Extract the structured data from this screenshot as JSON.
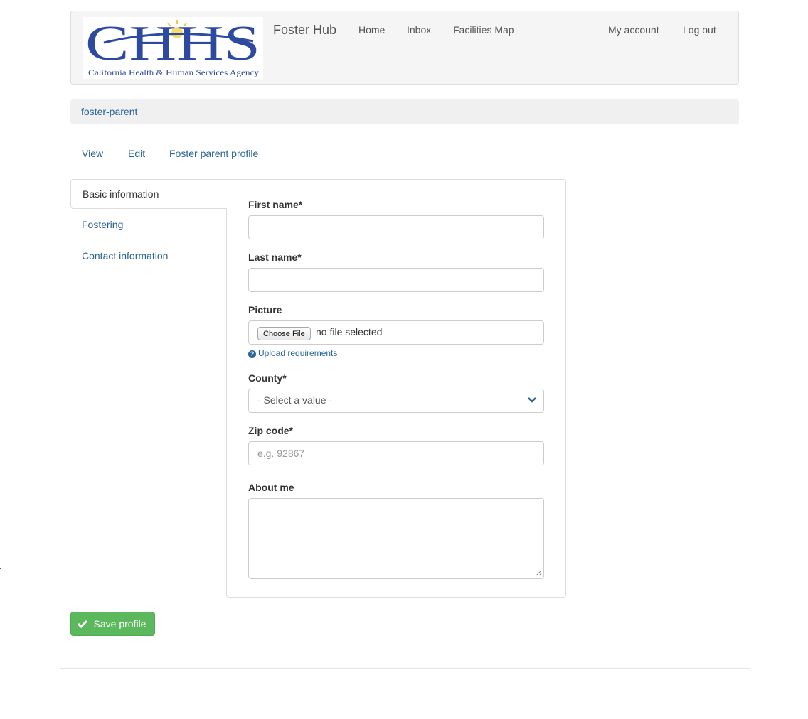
{
  "header": {
    "logo_alt": "CHHS California Health & Human Services Agency",
    "logo_letters": "CHHS",
    "logo_tagline": "California Health & Human Services Agency",
    "brand": "Foster Hub",
    "nav": [
      "Home",
      "Inbox",
      "Facilities Map"
    ],
    "user_nav": [
      "My account",
      "Log out"
    ]
  },
  "breadcrumb": {
    "current": "foster-parent"
  },
  "local_tabs": [
    "View",
    "Edit",
    "Foster parent profile"
  ],
  "vertical_tabs": {
    "items": [
      "Basic information",
      "Fostering",
      "Contact information"
    ],
    "active": "Basic information"
  },
  "form": {
    "first_name": {
      "label": "First name*",
      "value": "",
      "placeholder": ""
    },
    "last_name": {
      "label": "Last name*",
      "value": "",
      "placeholder": ""
    },
    "picture": {
      "label": "Picture",
      "button": "Choose File",
      "status": "no file selected",
      "help_link": "Upload requirements"
    },
    "county": {
      "label": "County*",
      "selected": "- Select a value -"
    },
    "zip": {
      "label": "Zip code*",
      "placeholder": "e.g. 92867"
    },
    "about": {
      "label": "About me",
      "value": ""
    }
  },
  "actions": {
    "save_label": "Save profile"
  },
  "colors": {
    "link": "#2a6496",
    "success": "#5cb85c",
    "navbar_bg": "#f5f5f5",
    "logo_blue": "#2e4aa0",
    "logo_sun": "#f2c94c"
  }
}
